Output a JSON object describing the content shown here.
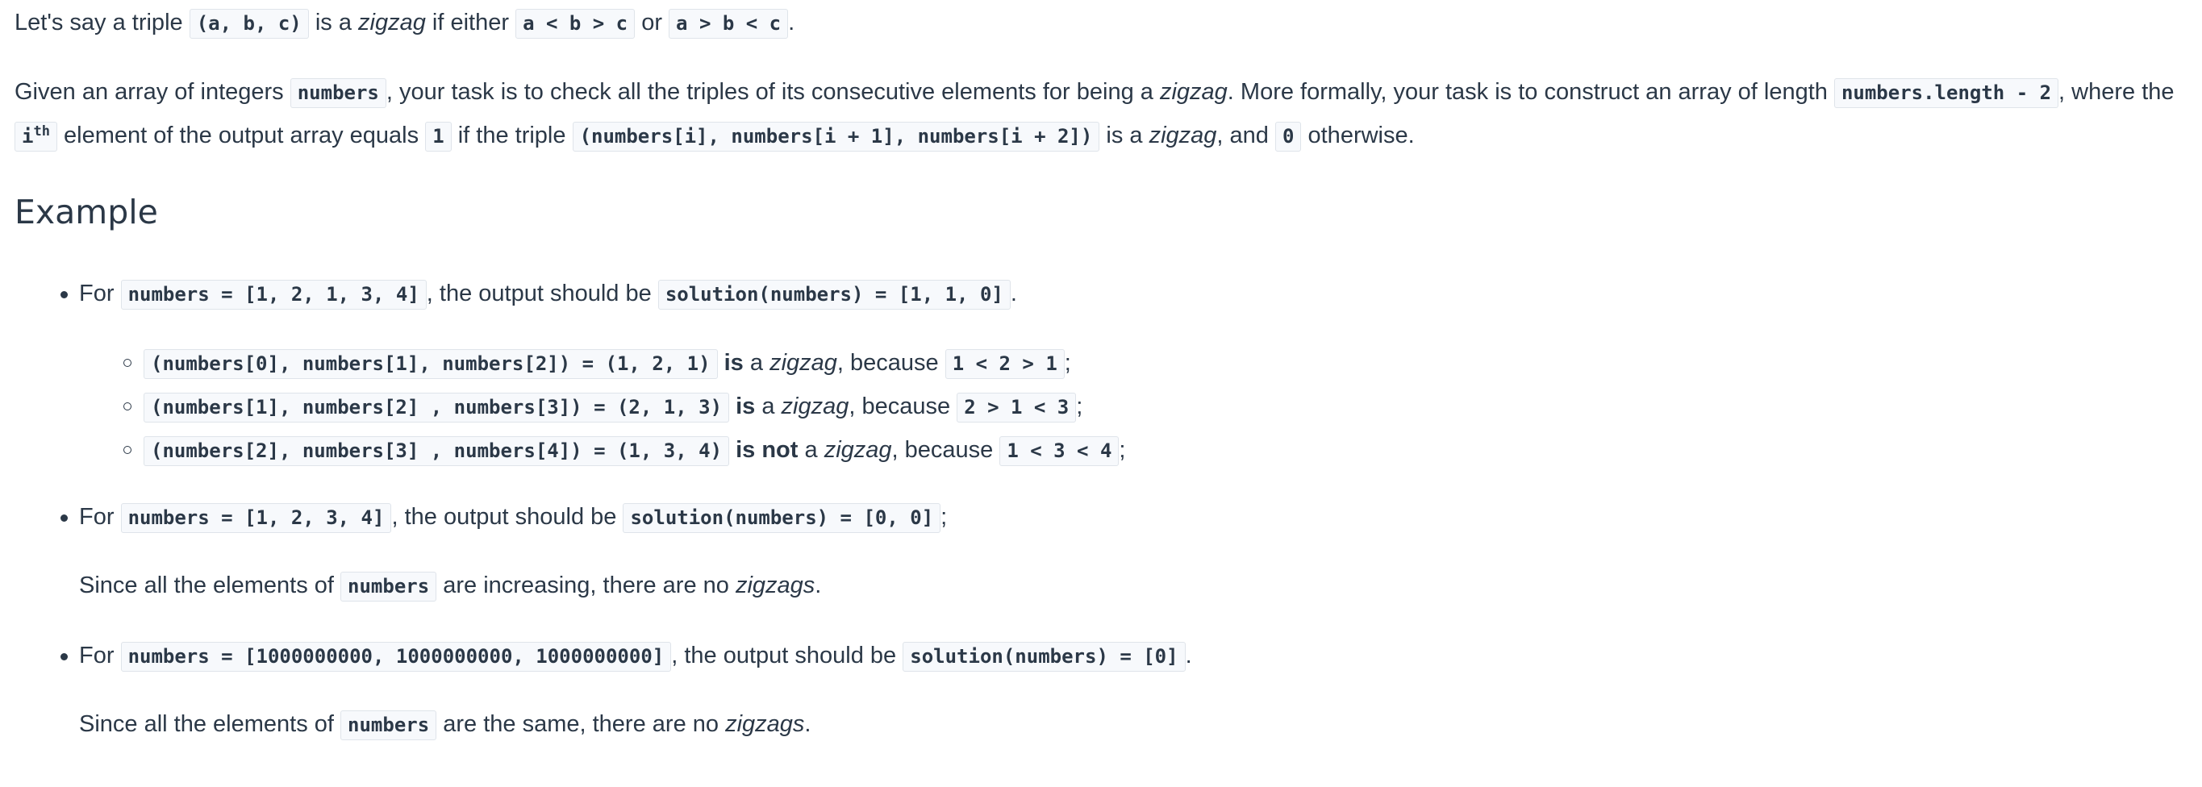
{
  "intro": {
    "t1": "Let's say a triple",
    "c1": "(a, b, c)",
    "t2": "is a",
    "e1": "zigzag",
    "t3": "if either",
    "c2": "a < b > c",
    "t4": "or",
    "c3": "a > b < c",
    "t5": "."
  },
  "task": {
    "t1": "Given an array of integers",
    "c1": "numbers",
    "t2": ", your task is to check all the triples of its consecutive elements for being a",
    "e1": "zigzag",
    "t3": ". More formally, your task is to construct an array of length",
    "c2": "numbers.length - 2",
    "t4": ", where the",
    "c3": "i",
    "sup": "th",
    "t5": "element of the output array equals",
    "c4": "1",
    "t6": "if the triple",
    "c5": "(numbers[i], numbers[i + 1], numbers[i + 2])",
    "t7": "is a",
    "e2": "zigzag",
    "t8": ", and",
    "c6": "0",
    "t9": "otherwise."
  },
  "example_heading": "Example",
  "ex1": {
    "for": "For",
    "input": "numbers = [1, 2, 1, 3, 4]",
    "mid": ", the output should be",
    "output": "solution(numbers) = [1, 1, 0]",
    "end": ".",
    "subs": [
      {
        "code": "(numbers[0], numbers[1], numbers[2]) = (1, 2, 1)",
        "is": "is",
        "a": "a",
        "zz": "zigzag",
        "because": ", because",
        "reason": "1 < 2 > 1",
        "semi": ";"
      },
      {
        "code": "(numbers[1], numbers[2] , numbers[3]) = (2, 1, 3)",
        "is": "is",
        "a": "a",
        "zz": "zigzag",
        "because": ", because",
        "reason": "2 > 1 < 3",
        "semi": ";"
      },
      {
        "code": "(numbers[2], numbers[3] , numbers[4]) = (1, 3, 4)",
        "is": "is not",
        "a": "a",
        "zz": "zigzag",
        "because": ", because",
        "reason": "1 < 3 < 4",
        "semi": ";"
      }
    ]
  },
  "ex2": {
    "for": "For",
    "input": "numbers = [1, 2, 3, 4]",
    "mid": ", the output should be",
    "output": "solution(numbers) = [0, 0]",
    "end": ";",
    "n1": "Since all the elements of",
    "nc": "numbers",
    "n2": "are increasing, there are no",
    "ne": "zigzags",
    "n3": "."
  },
  "ex3": {
    "for": "For",
    "input": "numbers = [1000000000, 1000000000, 1000000000]",
    "mid": ", the output should be",
    "output": "solution(numbers) = [0]",
    "end": ".",
    "n1": "Since all the elements of",
    "nc": "numbers",
    "n2": "are the same, there are no",
    "ne": "zigzags",
    "n3": "."
  }
}
